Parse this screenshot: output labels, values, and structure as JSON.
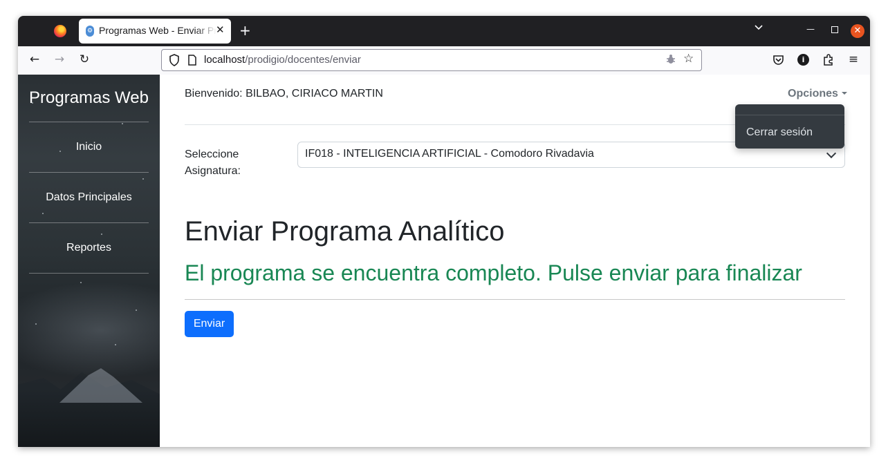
{
  "browser": {
    "tab_title": "Programas Web - Enviar Programa Analítico",
    "tab_close": "✕",
    "new_tab": "+",
    "url_host": "localhost",
    "url_path": "/prodigio/docentes/enviar"
  },
  "sidebar": {
    "brand": "Programas Web",
    "items": [
      {
        "label": "Inicio"
      },
      {
        "label": "Datos Principales"
      },
      {
        "label": "Reportes"
      }
    ]
  },
  "header": {
    "welcome": "Bienvenido: BILBAO, CIRIACO MARTIN",
    "options_label": "Opciones",
    "dropdown_item": "Cerrar sesión"
  },
  "form": {
    "select_label": "Seleccione Asignatura:",
    "select_value": "IF018 - INTELIGENCIA ARTIFICIAL - Comodoro Rivadavia"
  },
  "content": {
    "title": "Enviar Programa Analítico",
    "status": "El programa se encuentra completo. Pulse enviar para finalizar",
    "send_button": "Enviar"
  },
  "colors": {
    "sidebar_bg": "#2b3236",
    "primary": "#0d6efd",
    "success": "#198754",
    "dropdown_bg": "#343a40"
  }
}
